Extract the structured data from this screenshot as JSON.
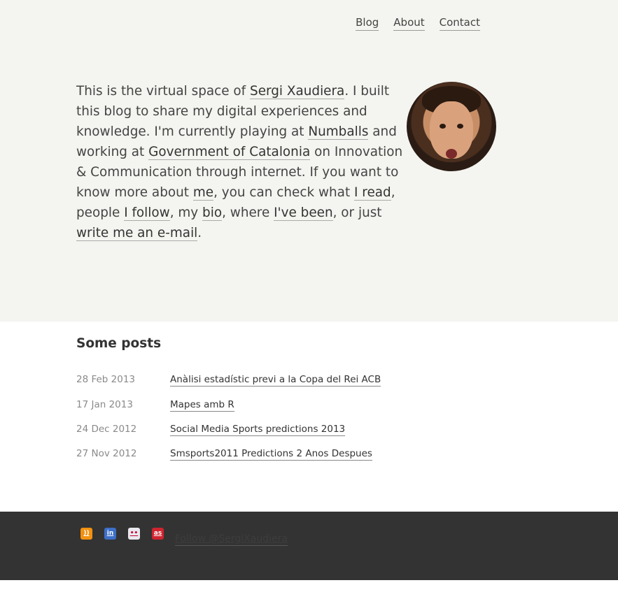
{
  "nav": {
    "items": [
      {
        "label": "Blog"
      },
      {
        "label": "About"
      },
      {
        "label": "Contact"
      }
    ]
  },
  "intro": {
    "t1": "This is the virtual space of ",
    "name_link": "Sergi Xaudiera",
    "t2": ". I built this blog to share my digital experiences and knowledge. I'm currently playing at ",
    "numballs_link": "Numballs",
    "t3": " and working at ",
    "gov_link": "Government of Catalonia",
    "t4": " on Innovation & Communication through internet. If you want to know more about ",
    "me_link": "me",
    "t5": ", you can check what ",
    "read_link": "I read",
    "t6": ", people ",
    "follow_link": "I follow",
    "t7": ", my ",
    "bio_link": "bio",
    "t8": ", where ",
    "been_link": "I've been",
    "t9": ", or just ",
    "email_link": "write me an e-mail",
    "t10": "."
  },
  "posts": {
    "heading": "Some posts",
    "items": [
      {
        "date": "28 Feb 2013",
        "title": "Anàlisi estadístic previ a la Copa del Rei ACB"
      },
      {
        "date": "17 Jan 2013",
        "title": "Mapes amb R"
      },
      {
        "date": "24 Dec 2012",
        "title": "Social Media Sports predictions 2013"
      },
      {
        "date": "27 Nov 2012",
        "title": "Smsports2011 Predictions 2 Anos Despues"
      }
    ]
  },
  "footer": {
    "icons": [
      {
        "name": "rss-icon",
        "glyph": "))",
        "color": "#f29111"
      },
      {
        "name": "linkedin-icon",
        "glyph": "in",
        "color": "#3d6fc7"
      },
      {
        "name": "flickr-icon",
        "glyph": "••",
        "color": "#e8e8ee"
      },
      {
        "name": "lastfm-icon",
        "glyph": "as",
        "color": "#d0242f"
      }
    ],
    "follow_text": "Follow @SergiXaudiera"
  }
}
